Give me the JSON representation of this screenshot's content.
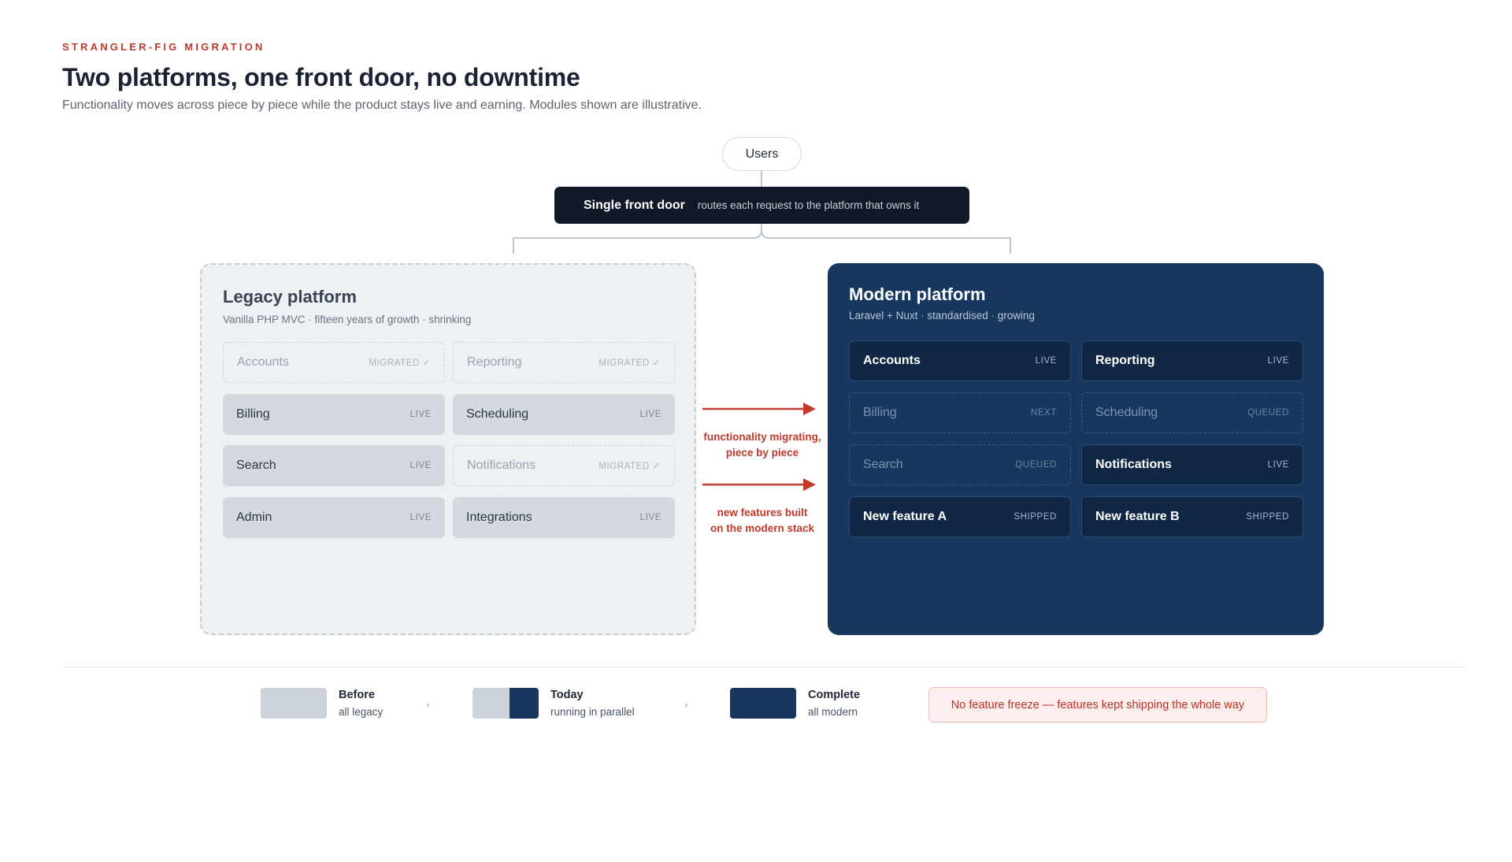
{
  "header": {
    "eyebrow": "STRANGLER-FIG MIGRATION",
    "title": "Two platforms, one front door, no downtime",
    "subtitle": "Functionality moves across piece by piece while the product stays live and earning. Modules shown are illustrative."
  },
  "users": {
    "label": "Users"
  },
  "front_door": {
    "title": "Single front door",
    "description": "routes each request to the platform that owns it"
  },
  "legacy": {
    "title": "Legacy platform",
    "subtitle": "Vanilla PHP MVC · fifteen years of growth · shrinking",
    "modules": [
      {
        "name": "Accounts",
        "status": "MIGRATED ✓"
      },
      {
        "name": "Reporting",
        "status": "MIGRATED ✓"
      },
      {
        "name": "Billing",
        "status": "LIVE"
      },
      {
        "name": "Scheduling",
        "status": "LIVE"
      },
      {
        "name": "Search",
        "status": "LIVE"
      },
      {
        "name": "Notifications",
        "status": "MIGRATED ✓"
      },
      {
        "name": "Admin",
        "status": "LIVE"
      },
      {
        "name": "Integrations",
        "status": "LIVE"
      }
    ]
  },
  "modern": {
    "title": "Modern platform",
    "subtitle": "Laravel + Nuxt · standardised · growing",
    "modules": [
      {
        "name": "Accounts",
        "status": "LIVE"
      },
      {
        "name": "Reporting",
        "status": "LIVE"
      },
      {
        "name": "Billing",
        "status": "NEXT"
      },
      {
        "name": "Scheduling",
        "status": "QUEUED"
      },
      {
        "name": "Search",
        "status": "QUEUED"
      },
      {
        "name": "Notifications",
        "status": "LIVE"
      },
      {
        "name": "New feature A",
        "status": "SHIPPED"
      },
      {
        "name": "New feature B",
        "status": "SHIPPED"
      }
    ]
  },
  "arrows": {
    "migrating_line1": "functionality migrating,",
    "migrating_line2": "piece by piece",
    "new_line1": "new features built",
    "new_line2": "on the modern stack"
  },
  "legend": {
    "before": {
      "title": "Before",
      "sub": "all legacy"
    },
    "today": {
      "title": "Today",
      "sub": "running in parallel"
    },
    "complete": {
      "title": "Complete",
      "sub": "all modern"
    },
    "chevron": "›",
    "note": "No feature freeze — features kept shipping the whole way"
  },
  "colors": {
    "accent_red": "#c0392b",
    "legacy_fill": "#d4d9e0",
    "modern_fill": "#17375e",
    "front_door": "#111827"
  }
}
